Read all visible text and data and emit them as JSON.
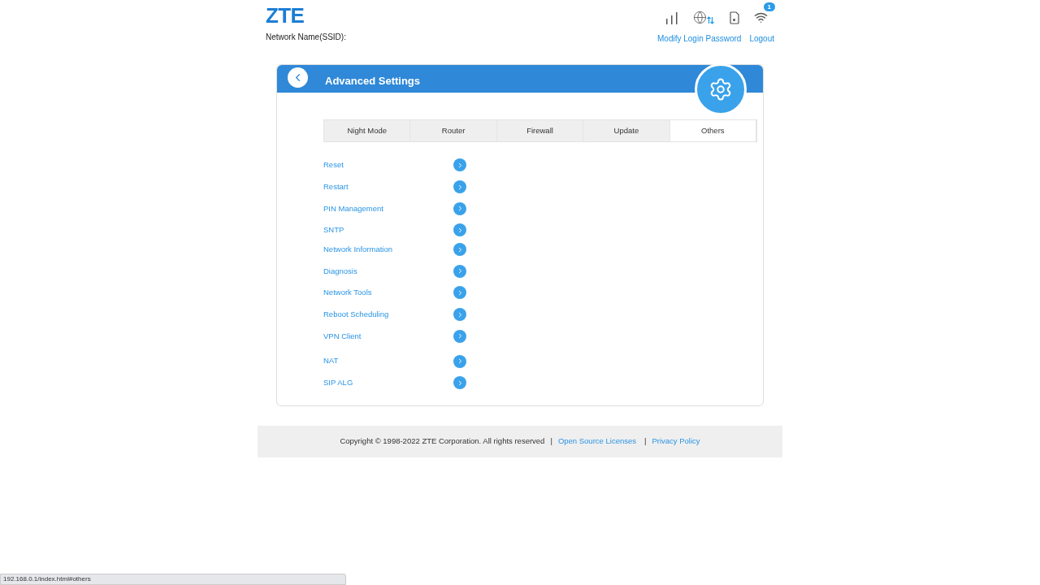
{
  "header": {
    "logo": "ZTE",
    "network_name_label": "Network Name(SSID):",
    "wifi_badge": "1",
    "links": [
      "Modify Login Password",
      "Logout"
    ]
  },
  "panel": {
    "title": "Advanced Settings",
    "tabs": [
      {
        "label": "Night Mode",
        "selected": false
      },
      {
        "label": "Router",
        "selected": false
      },
      {
        "label": "Firewall",
        "selected": false
      },
      {
        "label": "Update",
        "selected": false
      },
      {
        "label": "Others",
        "selected": true
      }
    ],
    "items": [
      "Reset",
      "Restart",
      "PIN Management",
      "SNTP",
      "Network Information",
      "Diagnosis",
      "Network Tools",
      "Reboot Scheduling",
      "VPN Client",
      "NAT",
      "SIP ALG"
    ]
  },
  "footer": {
    "copyright": "Copyright © 1998-2022 ZTE Corporation. All rights reserved",
    "separator_1": "|",
    "link_1": "Open Source Licenses",
    "separator_2": "|",
    "link_2": "Privacy Policy"
  },
  "status_url": "192.168.0.1/index.html#others"
}
